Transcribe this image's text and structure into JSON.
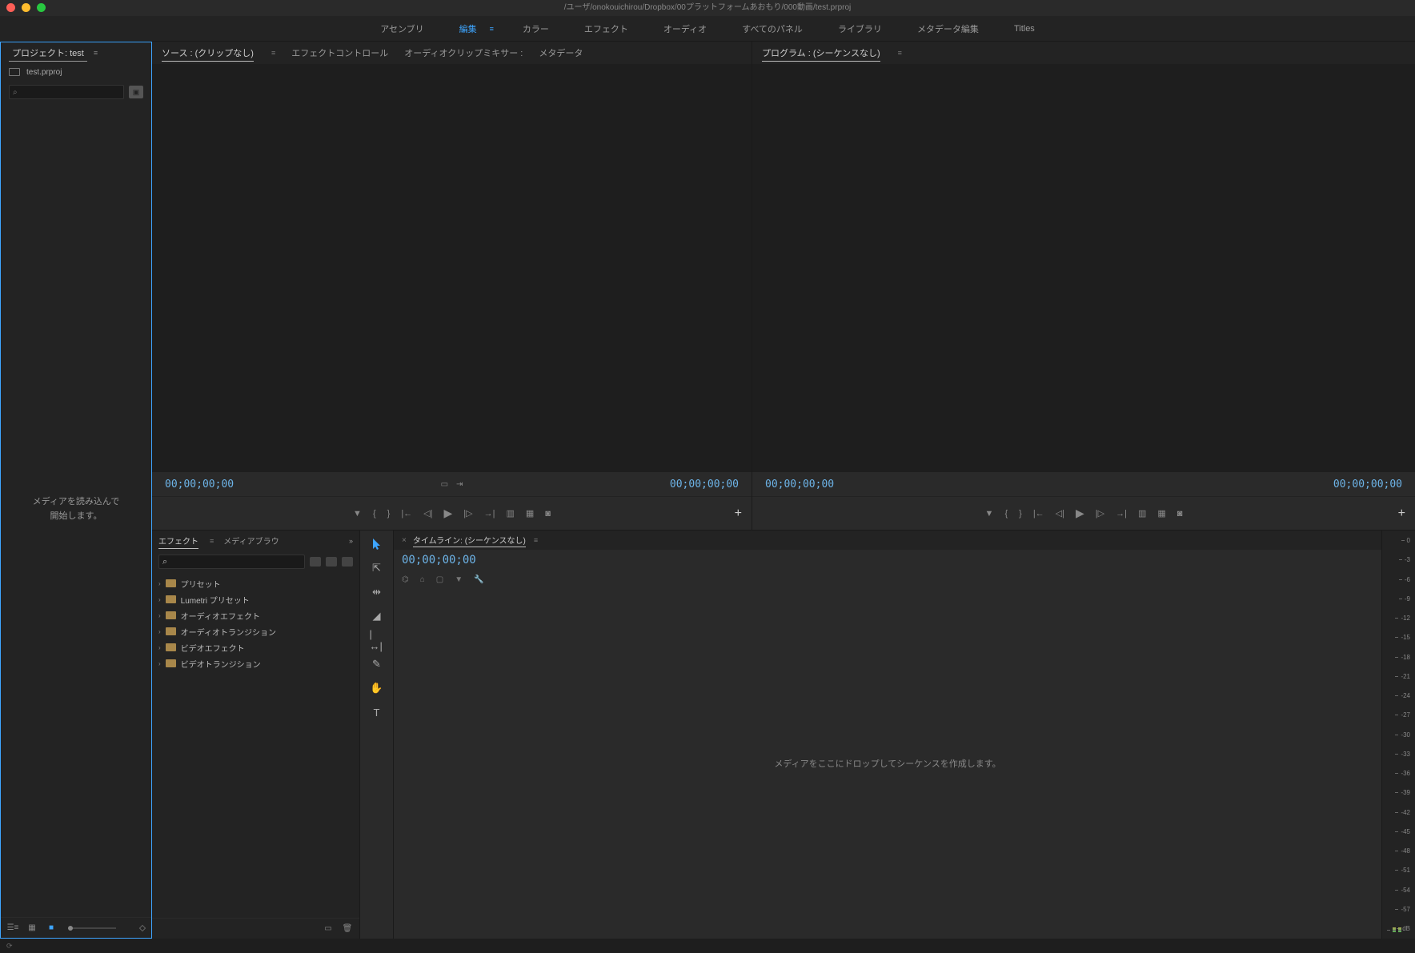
{
  "titlebar": "/ユーザ/onokouichirou/Dropbox/00プラットフォームあおもり/000動画/test.prproj",
  "workspaces": [
    {
      "label": "アセンブリ",
      "active": false
    },
    {
      "label": "編集",
      "active": true
    },
    {
      "label": "カラー",
      "active": false
    },
    {
      "label": "エフェクト",
      "active": false
    },
    {
      "label": "オーディオ",
      "active": false
    },
    {
      "label": "すべてのパネル",
      "active": false
    },
    {
      "label": "ライブラリ",
      "active": false
    },
    {
      "label": "メタデータ編集",
      "active": false
    },
    {
      "label": "Titles",
      "active": false
    }
  ],
  "project": {
    "tab_label": "プロジェクト: test",
    "file_name": "test.prproj",
    "empty_message_line1": "メディアを読み込んで",
    "empty_message_line2": "開始します。"
  },
  "source": {
    "tabs": [
      {
        "label": "ソース : (クリップなし)",
        "active": true
      },
      {
        "label": "エフェクトコントロール",
        "active": false
      },
      {
        "label": "オーディオクリップミキサー :",
        "active": false
      },
      {
        "label": "メタデータ",
        "active": false
      }
    ],
    "tc_left": "00;00;00;00",
    "tc_right": "00;00;00;00"
  },
  "program": {
    "tab_label": "プログラム : (シーケンスなし)",
    "tc_left": "00;00;00;00",
    "tc_right": "00;00;00;00"
  },
  "effects": {
    "tabs": [
      {
        "label": "エフェクト",
        "active": true
      },
      {
        "label": "メディアブラウ",
        "active": false
      }
    ],
    "nodes": [
      "プリセット",
      "Lumetri プリセット",
      "オーディオエフェクト",
      "オーディオトランジション",
      "ビデオエフェクト",
      "ビデオトランジション"
    ]
  },
  "tools": [
    "selection",
    "track-select",
    "ripple",
    "razor",
    "rate-stretch",
    "slip",
    "pen",
    "hand",
    "type"
  ],
  "timeline": {
    "tab_label": "タイムライン: (シーケンスなし)",
    "tc": "00;00;00;00",
    "drop_message": "メディアをここにドロップしてシーケンスを作成します。"
  },
  "meter_marks": [
    "0",
    "-3",
    "-6",
    "-9",
    "-12",
    "-15",
    "-18",
    "-21",
    "-24",
    "-27",
    "-30",
    "-33",
    "-36",
    "-39",
    "-42",
    "-45",
    "-48",
    "-51",
    "-54",
    "-57",
    "dB"
  ]
}
